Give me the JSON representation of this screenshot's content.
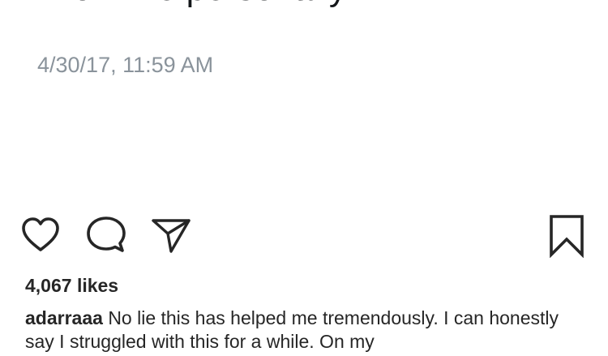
{
  "tweet": {
    "text": "know me personally.",
    "timestamp": "4/30/17, 11:59 AM"
  },
  "actions": {
    "like_icon": "heart-outline-icon",
    "comment_icon": "speech-bubble-icon",
    "share_icon": "paper-plane-icon",
    "save_icon": "bookmark-icon"
  },
  "post": {
    "likes": "4,067 likes",
    "caption_username": "adarraaa",
    "caption_text": "No lie this has helped me tremendously. I can honestly say I struggled with this for a while. On my"
  },
  "colors": {
    "text_primary": "#262626",
    "tweet_text": "#14171a",
    "tweet_timestamp": "#8a939b",
    "icon_stroke": "#262626",
    "background": "#ffffff"
  }
}
